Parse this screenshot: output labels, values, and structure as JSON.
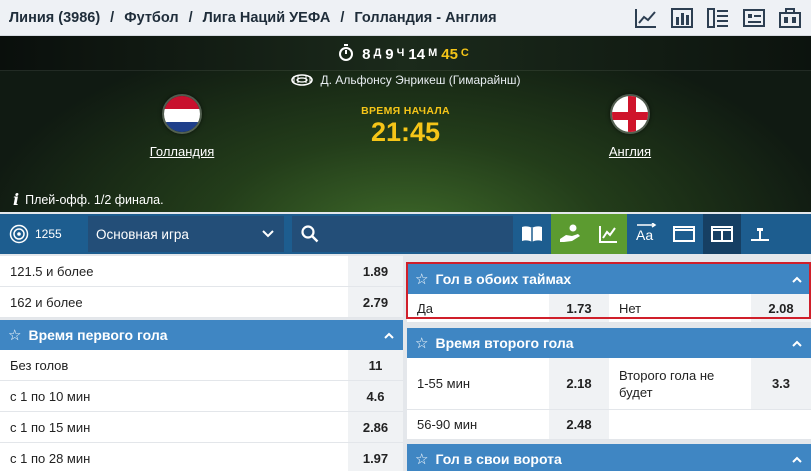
{
  "breadcrumb": {
    "items": [
      "Линия (3986)",
      "Футбол",
      "Лига Наций УЕФА",
      "Голландия - Англия"
    ],
    "separator": "/"
  },
  "header_icons": [
    "chart-line-icon",
    "bar-chart-icon",
    "list-icon",
    "settings-toggle-icon",
    "scoreboard-icon"
  ],
  "match": {
    "countdown": {
      "days": "8",
      "days_unit": "Д",
      "hours": "9",
      "hours_unit": "Ч",
      "minutes": "14",
      "minutes_unit": "М",
      "seconds": "45",
      "seconds_unit": "С"
    },
    "stadium": "Д. Альфонсу Энрикеш (Гимарайнш)",
    "home_team": "Голландия",
    "away_team": "Англия",
    "kickoff_label": "ВРЕМЯ НАЧАЛА",
    "kickoff_time": "21:45",
    "info": "Плей-офф. 1/2 финала."
  },
  "toolbar": {
    "count": "1255",
    "market_select": "Основная игра"
  },
  "left_column": {
    "top_rows": [
      {
        "label": "121.5 и более",
        "odd": "1.89"
      },
      {
        "label": "162 и более",
        "odd": "2.79"
      }
    ],
    "first_goal": {
      "title": "Время первого гола",
      "rows": [
        {
          "label": "Без голов",
          "odd": "11"
        },
        {
          "label": "с 1 по 10 мин",
          "odd": "4.6"
        },
        {
          "label": "с 1 по 15 мин",
          "odd": "2.86"
        },
        {
          "label": "с 1 по 28 мин",
          "odd": "1.97"
        }
      ]
    }
  },
  "right_column": {
    "both_halves": {
      "title": "Гол в обоих таймах",
      "yes_label": "Да",
      "yes_odd": "1.73",
      "no_label": "Нет",
      "no_odd": "2.08"
    },
    "second_goal": {
      "title": "Время второго гола",
      "r1_label": "1-55 мин",
      "r1_odd": "2.18",
      "r1b_label": "Второго гола не будет",
      "r1b_odd": "3.3",
      "r2_label": "56-90 мин",
      "r2_odd": "2.48"
    },
    "own_goal": {
      "title": "Гол в свои ворота"
    }
  },
  "colors": {
    "accent_blue": "#3f86c3",
    "toolbar_blue": "#1d5d8f",
    "kickoff_yellow": "#f5c518",
    "highlight_red": "#d01f2a",
    "green": "#5c9b30"
  }
}
